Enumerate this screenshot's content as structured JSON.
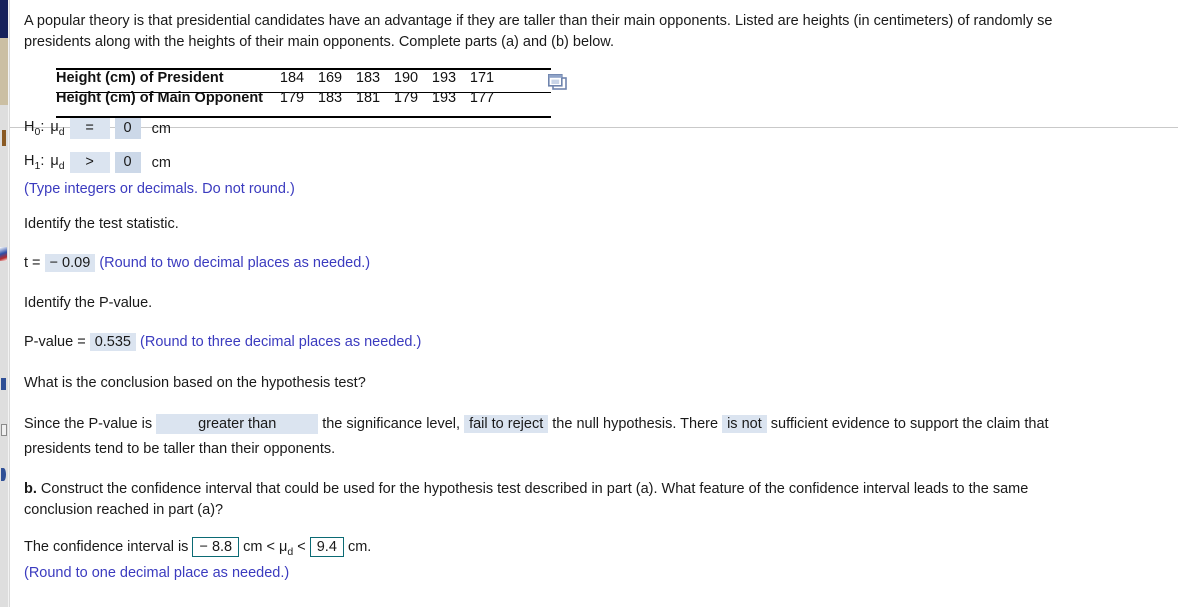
{
  "problem": {
    "intro": "A popular theory is that presidential candidates have an advantage if they are taller than their main opponents. Listed are heights (in centimeters) of randomly se\npresidents along with the heights of their main opponents. Complete parts (a) and (b) below."
  },
  "data_table": {
    "row_president_label": "Height (cm) of President",
    "row_opponent_label": "Height (cm) of Main Opponent",
    "president_heights": [
      "184",
      "169",
      "183",
      "190",
      "193",
      "171"
    ],
    "opponent_heights": [
      "179",
      "183",
      "181",
      "179",
      "193",
      "177"
    ],
    "popout_icon": "popout-window-icon"
  },
  "hypotheses": {
    "h0_label": "H",
    "h0_sub": "0",
    "h0_param": "μ",
    "h0_param_sub": "d",
    "h0_operator": "=",
    "h0_value": "0",
    "h0_unit": "cm",
    "h1_label": "H",
    "h1_sub": "1",
    "h1_param": "μ",
    "h1_param_sub": "d",
    "h1_operator": ">",
    "h1_value": "0",
    "h1_unit": "cm",
    "rounding_note": "(Type integers or decimals. Do not round.)"
  },
  "test_statistic": {
    "prompt": "Identify the test statistic.",
    "label": "t =",
    "value": "− 0.09",
    "note": "(Round to two decimal places as needed.)"
  },
  "p_value": {
    "prompt": "Identify the P-value.",
    "label": "P-value =",
    "value": "0.535",
    "note": "(Round to three decimal places as needed.)"
  },
  "conclusion": {
    "prompt": "What is the conclusion based on the hypothesis test?",
    "text_1": "Since the P-value is",
    "comparison": "greater than",
    "text_2": "the significance level,",
    "decision": "fail to reject",
    "text_3": "the null hypothesis. There",
    "evidence": "is not",
    "text_4": "sufficient evidence to support the claim that",
    "text_5": "presidents tend to be taller than their opponents."
  },
  "part_b": {
    "label": "b.",
    "question": "Construct the confidence interval that could be used for the hypothesis test described in part (a). What feature of the confidence interval leads to the same\nconclusion reached in part (a)?",
    "ci_prefix": "The confidence interval is",
    "ci_lower": "− 8.8",
    "ci_mid_1": "cm <",
    "ci_param": "μ",
    "ci_param_sub": "d",
    "ci_mid_2": "<",
    "ci_upper": "9.4",
    "ci_suffix": "cm.",
    "rounding_note": "(Round to one decimal place as needed.)"
  },
  "colors": {
    "blank_fill": "#dbe4f0",
    "input_border": "#0b6a74",
    "note_text": "#3b3bbf"
  }
}
